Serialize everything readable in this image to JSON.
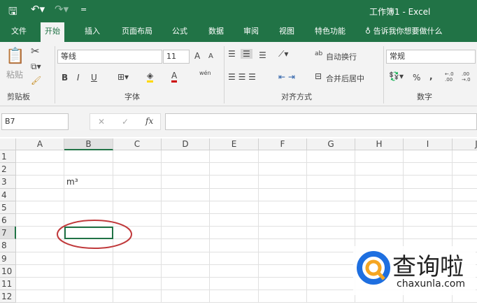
{
  "title": {
    "text": "工作簿1  -  Excel"
  },
  "qat": {
    "save_icon": "save-icon",
    "undo_icon": "undo-icon",
    "redo_icon": "redo-icon",
    "customize": "="
  },
  "tabs": [
    {
      "label": "文件"
    },
    {
      "label": "开始",
      "active": true
    },
    {
      "label": "插入"
    },
    {
      "label": "页面布局"
    },
    {
      "label": "公式"
    },
    {
      "label": "数据"
    },
    {
      "label": "审阅"
    },
    {
      "label": "视图"
    },
    {
      "label": "特色功能"
    }
  ],
  "tellme": "告诉我你想要做什么",
  "ribbon": {
    "clipboard": {
      "paste": "粘贴",
      "group": "剪贴板"
    },
    "font": {
      "name": "等线",
      "size": "11",
      "bold": "B",
      "italic": "I",
      "underline": "U",
      "group": "字体",
      "grow": "A",
      "shrink": "A",
      "phonetic": "wén"
    },
    "align": {
      "wrap": "自动换行",
      "merge": "合并后居中",
      "group": "对齐方式"
    },
    "number": {
      "format": "常规",
      "percent": "%",
      "comma": ",",
      "inc": "←.0 .00",
      "dec": ".00 →.0",
      "group": "数字"
    }
  },
  "formula_bar": {
    "name_box": "B7",
    "cancel": "✕",
    "enter": "✓",
    "fx": "fx",
    "value": ""
  },
  "sheet": {
    "columns": [
      "A",
      "B",
      "C",
      "D",
      "E",
      "F",
      "G",
      "H",
      "I",
      "J"
    ],
    "rows": [
      "1",
      "2",
      "3",
      "4",
      "5",
      "6",
      "7",
      "8",
      "9",
      "10",
      "11",
      "12"
    ],
    "active_cell": "B7",
    "cells": {
      "B3": "m³"
    }
  },
  "watermark": {
    "text": "查询啦",
    "url": "chaxunla.com"
  },
  "colors": {
    "brand": "#217346",
    "annotation": "#c0393b",
    "logo_blue": "#1e6fe0",
    "logo_orange": "#f5a623"
  }
}
